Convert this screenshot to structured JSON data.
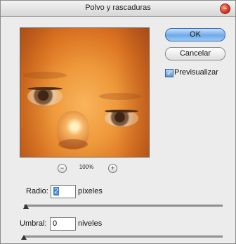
{
  "dialog": {
    "title": "Polvo y rascaduras"
  },
  "preview": {
    "zoom_level": "100%",
    "zoom_out_icon": "minus-circle-icon",
    "zoom_in_icon": "plus-circle-icon"
  },
  "buttons": {
    "ok_label": "OK",
    "cancel_label": "Cancelar"
  },
  "preview_toggle": {
    "label": "Previsualizar",
    "checked": true
  },
  "radius": {
    "label": "Radio:",
    "value": "2",
    "unit": "píxeles",
    "slider_fraction": 0.02
  },
  "threshold": {
    "label": "Umbral:",
    "value": "0",
    "unit": "niveles",
    "slider_fraction": 0.0
  },
  "colors": {
    "accent": "#6faae8",
    "close": "#d8341c"
  }
}
